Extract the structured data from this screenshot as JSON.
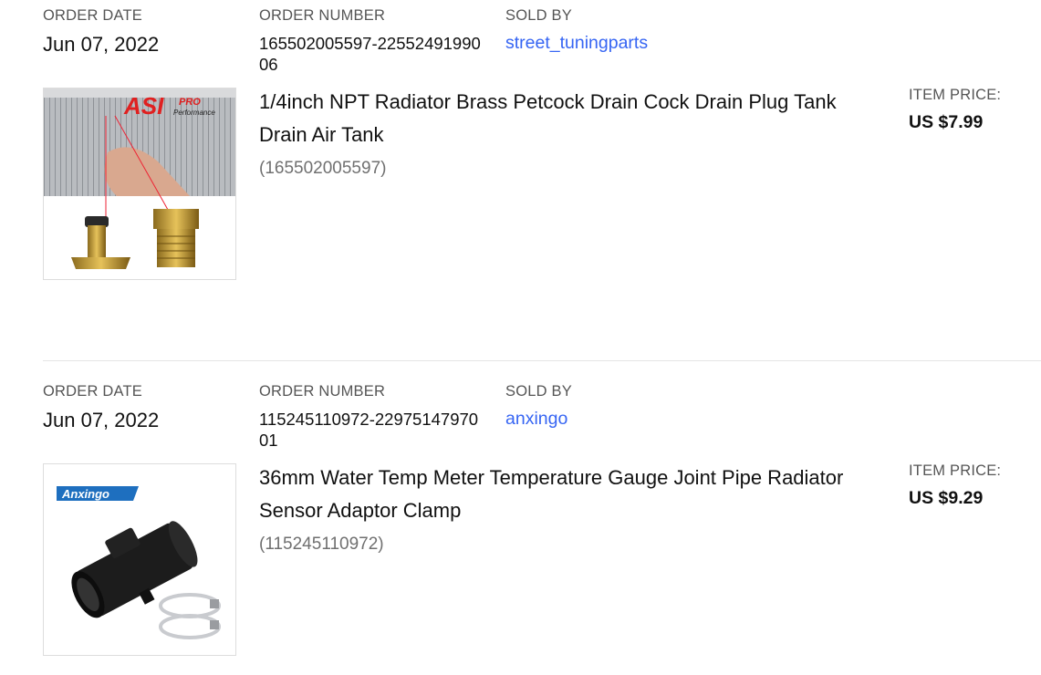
{
  "orders": [
    {
      "order_date_label": "ORDER DATE",
      "order_date": "Jun 07, 2022",
      "order_number_label": "ORDER NUMBER",
      "order_number": "165502005597-2255249199006",
      "sold_by_label": "SOLD BY",
      "seller": "street_tuningparts",
      "item_title": "1/4inch NPT Radiator Brass Petcock Drain Cock Drain Plug Tank Drain Air Tank",
      "item_id": "(165502005597)",
      "price_label": "ITEM PRICE:",
      "price": "US $7.99",
      "image_brand_text": "ASI PRO Performance"
    },
    {
      "order_date_label": "ORDER DATE",
      "order_date": "Jun 07, 2022",
      "order_number_label": "ORDER NUMBER",
      "order_number": "115245110972-2297514797001",
      "sold_by_label": "SOLD BY",
      "seller": "anxingo",
      "item_title": "36mm Water Temp Meter Temperature Gauge Joint Pipe Radiator Sensor Adaptor Clamp",
      "item_id": "(115245110972)",
      "price_label": "ITEM PRICE:",
      "price": "US $9.29",
      "image_brand_text": "Anxingo"
    }
  ],
  "colors": {
    "link": "#3665f3",
    "muted": "#707070",
    "text": "#111111"
  }
}
